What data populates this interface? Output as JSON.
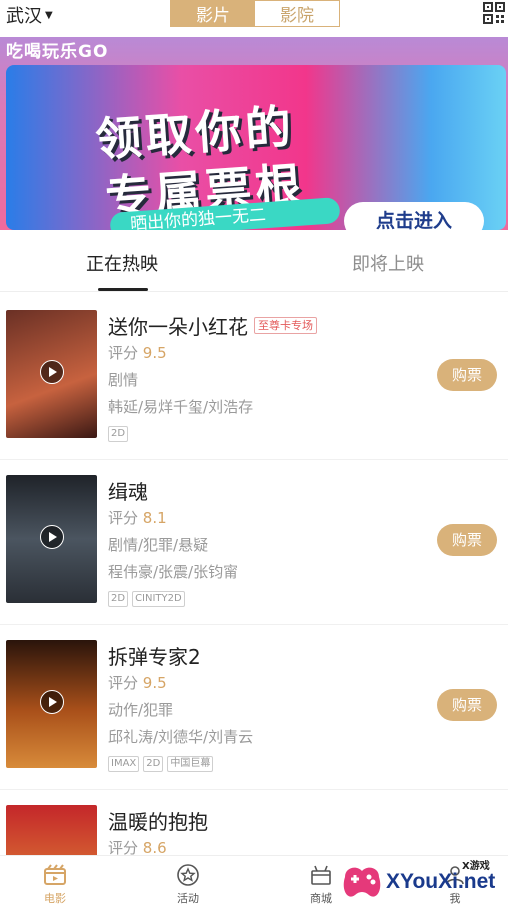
{
  "header": {
    "city": "武汉",
    "segments": [
      "影片",
      "影院"
    ]
  },
  "banner": {
    "logo": "吃喝玩乐GO",
    "headline_line1": "领取你的",
    "headline_line2": "专属票根",
    "ribbon": "晒出你的独一无二",
    "cta": "点击进入"
  },
  "tabs": [
    "正在热映",
    "即将上映"
  ],
  "movies": [
    {
      "title": "送你一朵小红花",
      "badge": "至尊卡专场",
      "score_label": "评分",
      "score": "9.5",
      "genre": "剧情",
      "cast": "韩延/易烊千玺/刘浩存",
      "tags": [
        "2D"
      ],
      "buy": "购票",
      "poster_colors": [
        "#7a3b2e",
        "#c05a3a"
      ]
    },
    {
      "title": "缉魂",
      "badge": "",
      "score_label": "评分",
      "score": "8.1",
      "genre": "剧情/犯罪/悬疑",
      "cast": "程伟豪/张震/张钧甯",
      "tags": [
        "2D",
        "CINITY2D"
      ],
      "buy": "购票",
      "poster_colors": [
        "#2b2f36",
        "#5a6470"
      ]
    },
    {
      "title": "拆弹专家2",
      "badge": "",
      "score_label": "评分",
      "score": "9.5",
      "genre": "动作/犯罪",
      "cast": "邱礼涛/刘德华/刘青云",
      "tags": [
        "IMAX",
        "2D",
        "中国巨幕"
      ],
      "buy": "购票",
      "poster_colors": [
        "#3a1e10",
        "#c8641e"
      ]
    },
    {
      "title": "温暖的抱抱",
      "badge": "",
      "score_label": "评分",
      "score": "8.6",
      "genre": "",
      "cast": "",
      "tags": [],
      "buy": "",
      "poster_colors": [
        "#c4272a",
        "#e8a43a"
      ]
    }
  ],
  "bottom_nav": {
    "items": [
      "电影",
      "活动",
      "商城",
      "我"
    ],
    "active": "电影"
  },
  "watermark": {
    "small": "X游戏",
    "main": "XYouXi.net"
  },
  "colors": {
    "accent": "#d9b27a",
    "score": "#d6a566",
    "badge_red": "#e35a5a"
  }
}
